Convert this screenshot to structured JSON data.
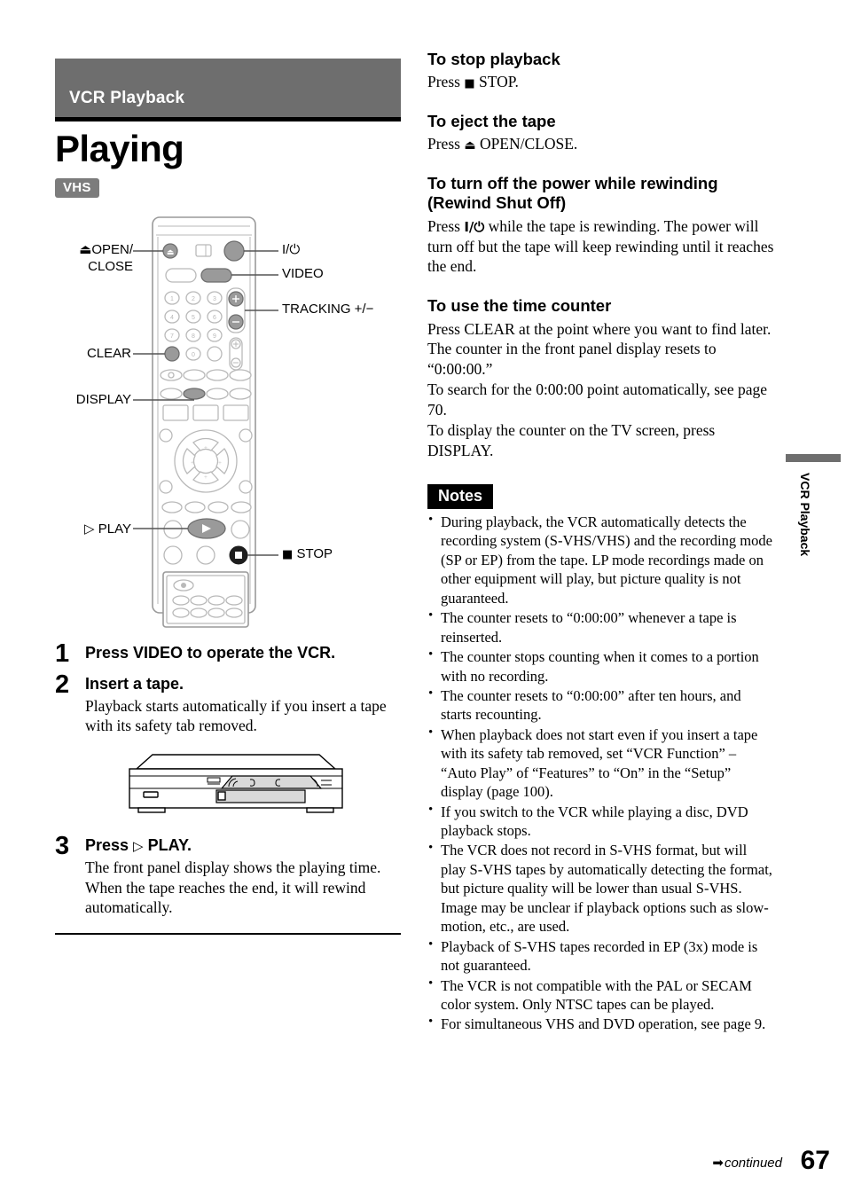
{
  "section": {
    "banner_label": "VCR Playback",
    "page_title": "Playing",
    "format_badge": "VHS"
  },
  "remote_callouts": {
    "open_close_line1": "OPEN/",
    "open_close_line2": "CLOSE",
    "open_close_glyph": "⏏",
    "clear": "CLEAR",
    "display": "DISPLAY",
    "play": "PLAY",
    "play_glyph": "▷",
    "power": "I/⏻",
    "video": "VIDEO",
    "tracking": "TRACKING +/−",
    "stop": "STOP",
    "stop_glyph": "■",
    "keypad": [
      "1",
      "2",
      "3",
      "4",
      "5",
      "6",
      "7",
      "8",
      "9",
      "0"
    ]
  },
  "steps": [
    {
      "num": "1",
      "head": "Press VIDEO to operate the VCR.",
      "text": ""
    },
    {
      "num": "2",
      "head": "Insert a tape.",
      "text": "Playback starts automatically if you insert a tape with its safety tab removed."
    },
    {
      "num": "3",
      "head_pre": "Press ",
      "head_glyph": "▷",
      "head_post": " PLAY.",
      "text": "The front panel display shows the playing time.\nWhen the tape reaches the end, it will rewind automatically."
    }
  ],
  "right_sections": [
    {
      "head": "To stop playback",
      "body_pre": "Press ",
      "body_glyph": "■",
      "body_post": " STOP."
    },
    {
      "head": "To eject the tape",
      "body_pre": "Press ",
      "body_glyph": "⏏",
      "body_post": " OPEN/CLOSE."
    },
    {
      "head": "To turn off the power while rewinding (Rewind Shut Off)",
      "body_pre": "Press ",
      "body_glyph": "I/⏻",
      "body_post": " while the tape is rewinding. The power will turn off but the tape will keep rewinding until it reaches the end."
    },
    {
      "head": "To use the time counter",
      "body_pre": "",
      "body_glyph": "",
      "body_post": "Press CLEAR at the point where you want to find later. The counter in the front panel display resets to “0:00:00.”\nTo search for the 0:00:00 point automatically, see page 70.\nTo display the counter on the TV screen, press DISPLAY."
    }
  ],
  "notes": {
    "tag": "Notes",
    "items": [
      "During playback, the VCR automatically detects the recording system (S-VHS/VHS) and the recording mode (SP or EP) from the tape. LP mode recordings made on other equipment will play, but picture quality is not guaranteed.",
      "The counter resets to “0:00:00” whenever a tape is reinserted.",
      "The counter stops counting when it comes to a portion with no recording.",
      "The counter resets to “0:00:00” after ten hours, and starts recounting.",
      "When playback does not start even if you insert a tape with its safety tab removed, set “VCR Function” – “Auto Play” of “Features” to “On” in the “Setup” display (page 100).",
      "If you switch to the VCR while playing a disc, DVD playback stops.",
      "The VCR does not record in S-VHS format, but will play S-VHS tapes by automatically detecting the format, but picture quality will be lower than usual S-VHS. Image may be unclear if playback options such as slow-motion, etc., are used.",
      "Playback of S-VHS tapes recorded in EP (3x) mode is not guaranteed.",
      "The VCR is not compatible with the PAL or SECAM color system. Only NTSC tapes can be played.",
      "For simultaneous VHS and DVD operation, see page 9."
    ]
  },
  "side_tab": {
    "label": "VCR Playback"
  },
  "footer": {
    "arrow": "➡",
    "continued": "continued",
    "page_number": "67"
  },
  "colors": {
    "banner_gray": "#6e6e6e",
    "badge_gray": "#7c7c7c",
    "notes_black": "#000000",
    "button_highlight": "#9a9a9a"
  }
}
